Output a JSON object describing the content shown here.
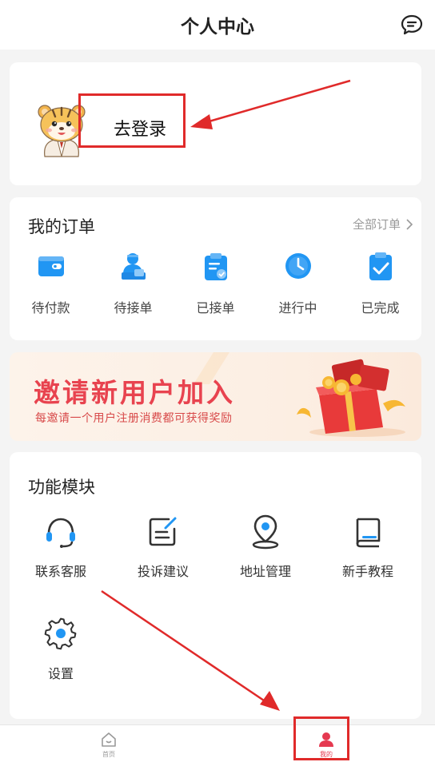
{
  "header": {
    "title": "个人中心",
    "message_icon": "chat-bubble-icon"
  },
  "login": {
    "avatar_icon": "tiger-mascot-avatar",
    "label": "去登录"
  },
  "orders": {
    "title": "我的订单",
    "all_label": "全部订单",
    "items": [
      {
        "label": "待付款",
        "icon": "wallet-icon"
      },
      {
        "label": "待接单",
        "icon": "courier-icon"
      },
      {
        "label": "已接单",
        "icon": "clipboard-icon"
      },
      {
        "label": "进行中",
        "icon": "clock-icon"
      },
      {
        "label": "已完成",
        "icon": "check-clipboard-icon"
      }
    ]
  },
  "banner": {
    "title": "邀请新用户加入",
    "subtitle": "每邀请一个用户注册消费都可获得奖励",
    "image": "red-gift-box-with-coins"
  },
  "functions": {
    "title": "功能模块",
    "items": [
      {
        "label": "联系客服",
        "icon": "headset-icon"
      },
      {
        "label": "投诉建议",
        "icon": "edit-note-icon"
      },
      {
        "label": "地址管理",
        "icon": "location-pin-icon"
      },
      {
        "label": "新手教程",
        "icon": "book-icon"
      },
      {
        "label": "设置",
        "icon": "gear-icon"
      }
    ]
  },
  "tabbar": {
    "tabs": [
      {
        "label": "首页",
        "icon": "home-icon",
        "active": false
      },
      {
        "label": "我的",
        "icon": "user-icon",
        "active": true
      }
    ]
  },
  "colors": {
    "accent": "#e53950",
    "icon_blue": "#2196f3",
    "annotation_red": "#e02a2a",
    "background": "#f4f4f4"
  }
}
